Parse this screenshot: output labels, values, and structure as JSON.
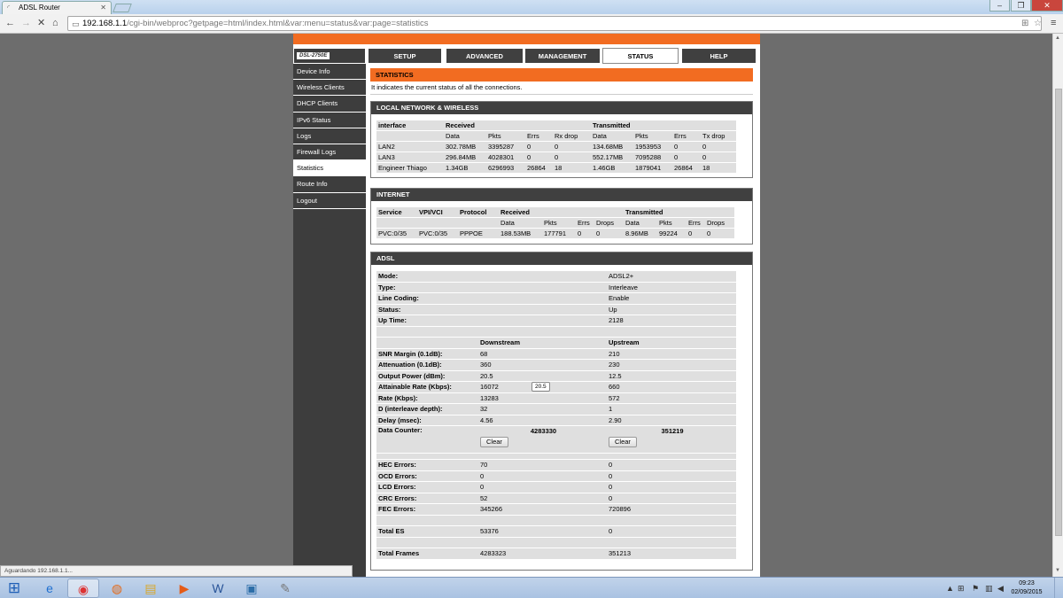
{
  "browser": {
    "tab_title": "ADSL Router",
    "url_host": "192.168.1.1",
    "url_path": "/cgi-bin/webproc?getpage=html/index.html&var:menu=status&var:page=statistics",
    "status_text": "Aguardando 192.168.1.1..."
  },
  "router": {
    "model": "DSL-2750E",
    "nav": [
      "SETUP",
      "ADVANCED",
      "MANAGEMENT",
      "STATUS",
      "HELP"
    ],
    "sidebar": [
      "Device Info",
      "Wireless Clients",
      "DHCP Clients",
      "IPv6 Status",
      "Logs",
      "Firewall Logs",
      "Statistics",
      "Route Info",
      "Logout"
    ]
  },
  "statistics": {
    "title": "STATISTICS",
    "description": "It indicates the current status of all the connections."
  },
  "lan": {
    "title": "LOCAL NETWORK & WIRELESS",
    "h_interface": "interface",
    "h_received": "Received",
    "h_transmitted": "Transmitted",
    "sub": [
      "Data",
      "Pkts",
      "Errs",
      "Rx drop",
      "Data",
      "Pkts",
      "Errs",
      "Tx drop"
    ],
    "rows": [
      {
        "c": [
          "LAN2",
          "302.78MB",
          "3395287",
          "0",
          "0",
          "134.68MB",
          "1953953",
          "0",
          "0"
        ]
      },
      {
        "c": [
          "LAN3",
          "296.84MB",
          "4028301",
          "0",
          "0",
          "552.17MB",
          "7095288",
          "0",
          "0"
        ]
      },
      {
        "c": [
          "Engineer Thiago",
          "1.34GB",
          "6296993",
          "26864",
          "18",
          "1.46GB",
          "1879041",
          "26864",
          "18"
        ]
      }
    ]
  },
  "internet": {
    "title": "INTERNET",
    "h": [
      "Service",
      "VPI/VCI",
      "Protocol",
      "Received",
      "Transmitted"
    ],
    "sub": [
      "Data",
      "Pkts",
      "Errs",
      "Drops",
      "Data",
      "Pkts",
      "Errs",
      "Drops"
    ],
    "row": [
      "PVC:0/35",
      "PVC:0/35",
      "PPPOE",
      "188.53MB",
      "177791",
      "0",
      "0",
      "8.96MB",
      "99224",
      "0",
      "0"
    ]
  },
  "adsl": {
    "title": "ADSL",
    "mode_label": "Mode:",
    "mode": "ADSL2+",
    "type_label": "Type:",
    "type": "Interleave",
    "coding_label": "Line Coding:",
    "coding": "Enable",
    "status_label": "Status:",
    "status": "Up",
    "uptime_label": "Up Time:",
    "uptime": "2128",
    "downstream": "Downstream",
    "upstream": "Upstream",
    "metrics": [
      {
        "label": "SNR Margin (0.1dB):",
        "down": "68",
        "up": "210"
      },
      {
        "label": "Attenuation (0.1dB):",
        "down": "360",
        "up": "230"
      },
      {
        "label": "Output Power (dBm):",
        "down": "20.5",
        "up": "12.5"
      },
      {
        "label": "Attainable Rate (Kbps):",
        "down": "16072",
        "up": "660"
      },
      {
        "label": "Rate (Kbps):",
        "down": "13283",
        "up": "572"
      },
      {
        "label": "D (interleave depth):",
        "down": "32",
        "up": "1"
      },
      {
        "label": "Delay (msec):",
        "down": "4.56",
        "up": "2.90"
      }
    ],
    "tooltip": "20.5",
    "counter_label": "Data Counter:",
    "counter_down": "4283330",
    "counter_up": "351219",
    "clear": "Clear",
    "errors": [
      {
        "label": "HEC Errors:",
        "down": "70",
        "up": "0"
      },
      {
        "label": "OCD Errors:",
        "down": "0",
        "up": "0"
      },
      {
        "label": "LCD Errors:",
        "down": "0",
        "up": "0"
      },
      {
        "label": "CRC Errors:",
        "down": "52",
        "up": "0"
      },
      {
        "label": "FEC Errors:",
        "down": "345266",
        "up": "720896"
      }
    ],
    "total_es_label": "Total ES",
    "total_es_down": "53376",
    "total_es_up": "0",
    "total_frames_label": "Total Frames",
    "total_frames_down": "4283323",
    "total_frames_up": "351213"
  },
  "taskbar": {
    "time": "09:23",
    "date": "02/09/2015"
  }
}
